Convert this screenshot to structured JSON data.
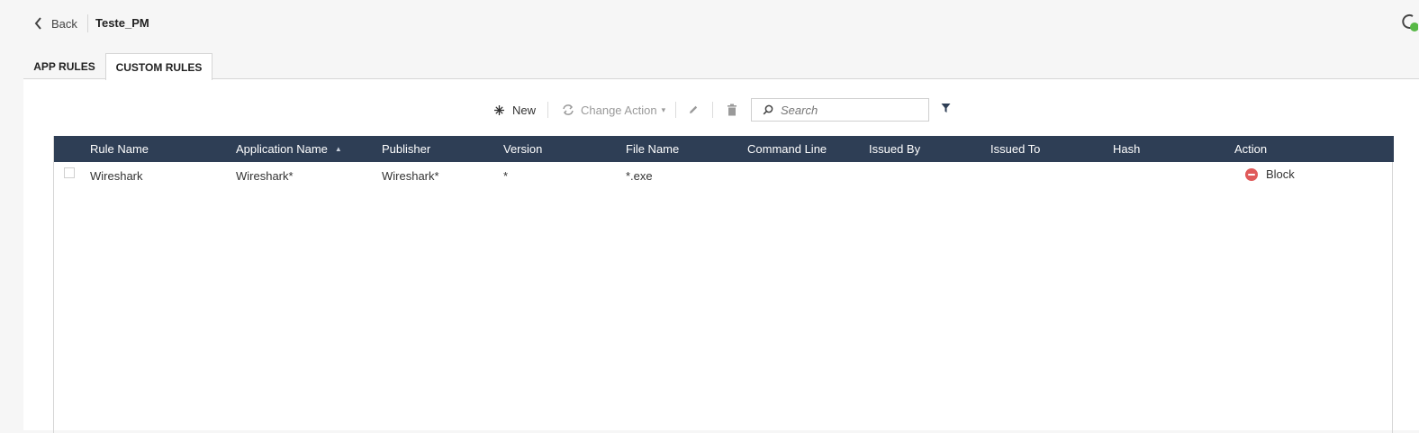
{
  "header": {
    "back_label": "Back",
    "title": "Teste_PM"
  },
  "tabs": [
    {
      "label": "APP RULES",
      "active": false
    },
    {
      "label": "CUSTOM RULES",
      "active": true
    }
  ],
  "toolbar": {
    "new_label": "New",
    "change_action_label": "Change Action",
    "search_placeholder": "Search"
  },
  "table": {
    "columns": [
      "Rule Name",
      "Application Name",
      "Publisher",
      "Version",
      "File Name",
      "Command Line",
      "Issued By",
      "Issued To",
      "Hash",
      "Action"
    ],
    "sorted_column": "Application Name",
    "sort_direction": "ascending",
    "rows": [
      {
        "rule_name": "Wireshark",
        "application_name": "Wireshark*",
        "publisher": "Wireshark*",
        "version": "*",
        "file_name": "*.exe",
        "command_line": "",
        "issued_by": "",
        "issued_to": "",
        "hash": "",
        "action": "Block"
      }
    ]
  },
  "colors": {
    "header_bg": "#2e3e55",
    "block_icon": "#e05a5a",
    "page_bg": "#f6f6f6"
  }
}
